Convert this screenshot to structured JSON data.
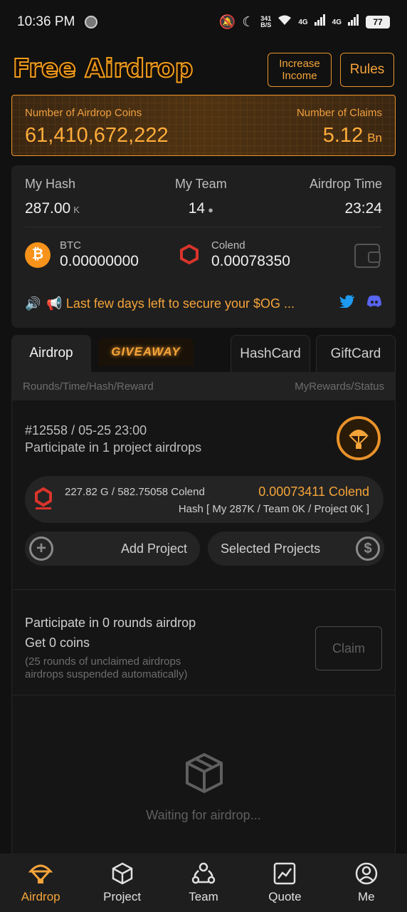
{
  "status_bar": {
    "time": "10:36 PM",
    "speed_top": "341",
    "speed_bottom": "B/S",
    "net1": "4G",
    "net2": "4G",
    "battery": "77"
  },
  "header": {
    "logo": "Free Airdrop",
    "increase_income": "Increase Income",
    "rules": "Rules"
  },
  "coins_panel": {
    "coins_label": "Number of Airdrop Coins",
    "coins_value": "61,410,672,222",
    "claims_label": "Number of Claims",
    "claims_value": "5.12",
    "claims_unit": "Bn"
  },
  "stats": {
    "my_hash_label": "My Hash",
    "my_hash_value": "287.00",
    "my_hash_unit": "K",
    "my_team_label": "My Team",
    "my_team_value": "14",
    "airdrop_time_label": "Airdrop Time",
    "airdrop_time_value": "23:24",
    "btc_name": "BTC",
    "btc_amount": "0.00000000",
    "colend_name": "Colend",
    "colend_amount": "0.00078350",
    "announcement": "📢 Last few days left to secure your $OG ..."
  },
  "tabs": {
    "airdrop": "Airdrop",
    "giveaway": "GIVEAWAY",
    "hashcard": "HashCard",
    "giftcard": "GiftCard"
  },
  "list_head": {
    "left": "Rounds/Time/Hash/Reward",
    "right": "MyRewards/Status"
  },
  "round": {
    "id": "#12558 / 05-25 23:00",
    "participate": "Participate in 1 project airdrops",
    "project_amount": "227.82 G / 582.75058 Colend",
    "project_reward": "0.00073411 Colend",
    "project_hash": "Hash [ My 287K / Team 0K / Project 0K ]",
    "add_project": "Add Project",
    "selected_projects": "Selected Projects"
  },
  "claim": {
    "line1": "Participate in 0 rounds airdrop",
    "line2": "Get 0 coins",
    "line3": "(25 rounds of unclaimed airdrops airdrops suspended automatically)",
    "button": "Claim"
  },
  "waiting": {
    "text": "Waiting for airdrop..."
  },
  "bottom_nav": {
    "airdrop": "Airdrop",
    "project": "Project",
    "team": "Team",
    "quote": "Quote",
    "me": "Me"
  },
  "colors": {
    "accent": "#f5a43a",
    "background": "#111111",
    "card": "#1f1f1f"
  }
}
